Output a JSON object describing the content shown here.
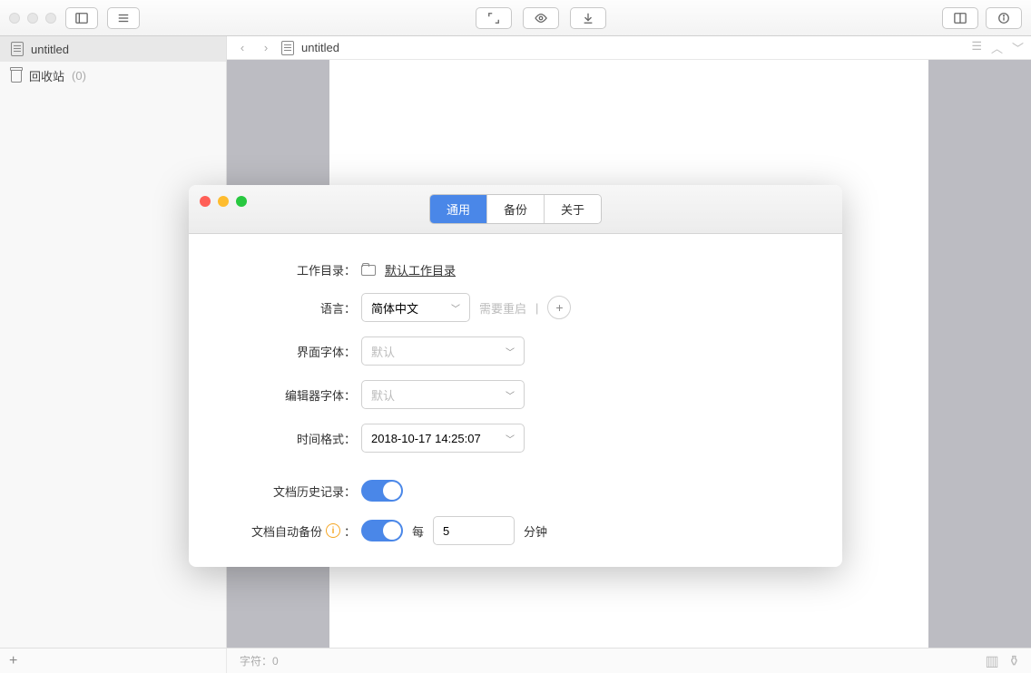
{
  "main_window": {
    "sidebar": {
      "document_name": "untitled",
      "trash_label": "回收站",
      "trash_count": "(0)"
    },
    "header": {
      "document_name": "untitled"
    },
    "status": {
      "char_label": "字符：",
      "char_count": "0"
    }
  },
  "dialog": {
    "tabs": {
      "general": "通用",
      "backup": "备份",
      "about": "关于"
    },
    "fields": {
      "work_dir": {
        "label": "工作目录：",
        "value": "默认工作目录"
      },
      "language": {
        "label": "语言：",
        "value": "简体中文",
        "hint": "需要重启"
      },
      "ui_font": {
        "label": "界面字体：",
        "placeholder": "默认"
      },
      "editor_font": {
        "label": "编辑器字体：",
        "placeholder": "默认"
      },
      "time_format": {
        "label": "时间格式：",
        "value": "2018-10-17 14:25:07"
      },
      "history": {
        "label": "文档历史记录：",
        "enabled": true
      },
      "auto_backup": {
        "label": "文档自动备份",
        "enabled": true,
        "every_label": "每",
        "interval": "5",
        "unit": "分钟"
      }
    }
  }
}
